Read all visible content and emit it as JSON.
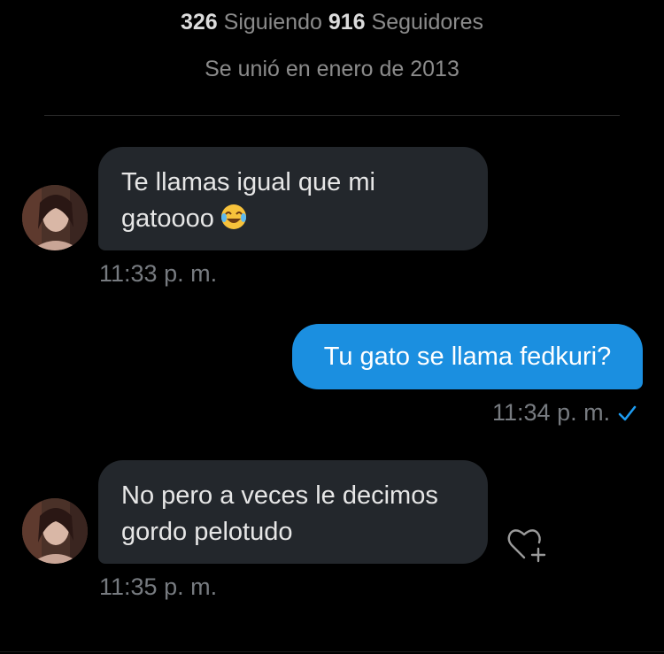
{
  "profile": {
    "following_count": "326",
    "following_label": "Siguiendo",
    "followers_count": "916",
    "followers_label": "Seguidores",
    "joined": "Se unió en enero de 2013"
  },
  "messages": [
    {
      "direction": "incoming",
      "lines": [
        "Te llamas igual que mi",
        "gatoooo"
      ],
      "emoji": "face-with-tears-of-joy",
      "time": "11:33 p. m."
    },
    {
      "direction": "outgoing",
      "text": "Tu gato se llama fedkuri?",
      "time": "11:34 p. m.",
      "status_icon": "check-icon"
    },
    {
      "direction": "incoming",
      "lines": [
        "No pero a veces le decimos",
        "gordo pelotudo"
      ],
      "time": "11:35 p. m.",
      "reaction_icon": "heart-plus-icon"
    }
  ],
  "colors": {
    "background": "#000000",
    "incoming_bubble": "#23272c",
    "outgoing_bubble": "#1b8fe0",
    "check": "#1d9bf0"
  }
}
